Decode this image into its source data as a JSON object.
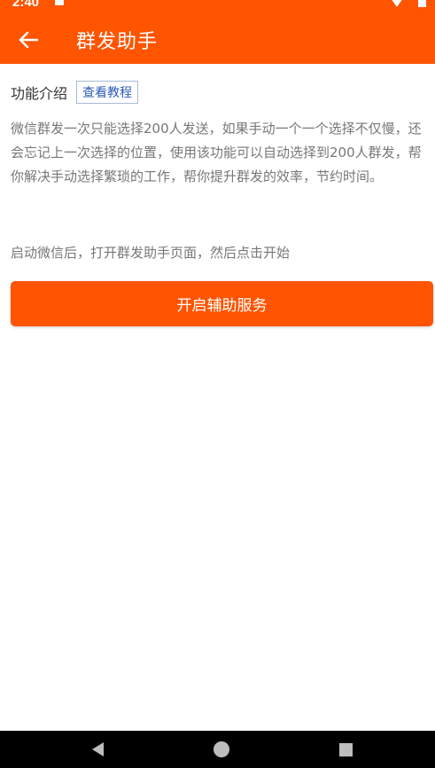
{
  "status_bar": {
    "time": "2:40"
  },
  "header": {
    "title": "群发助手",
    "back_icon": "arrow-left-icon"
  },
  "intro": {
    "label": "功能介绍",
    "tutorial_link": "查看教程"
  },
  "description": "微信群发一次只能选择200人发送，如果手动一个一个选择不仅慢，还会忘记上一次选择的位置，使用该功能可以自动选择到200人群发，帮你解决手动选择繁琐的工作，帮你提升群发的效率，节约时间。",
  "hint": "启动微信后，打开群发助手页面，然后点击开始",
  "start_button": "开启辅助服务",
  "colors": {
    "accent": "#ff5400",
    "nav_bar": "#000000",
    "link": "#2b5bb8"
  },
  "nav": {
    "back_icon": "triangle-back-icon",
    "home_icon": "circle-home-icon",
    "recent_icon": "square-recents-icon"
  }
}
